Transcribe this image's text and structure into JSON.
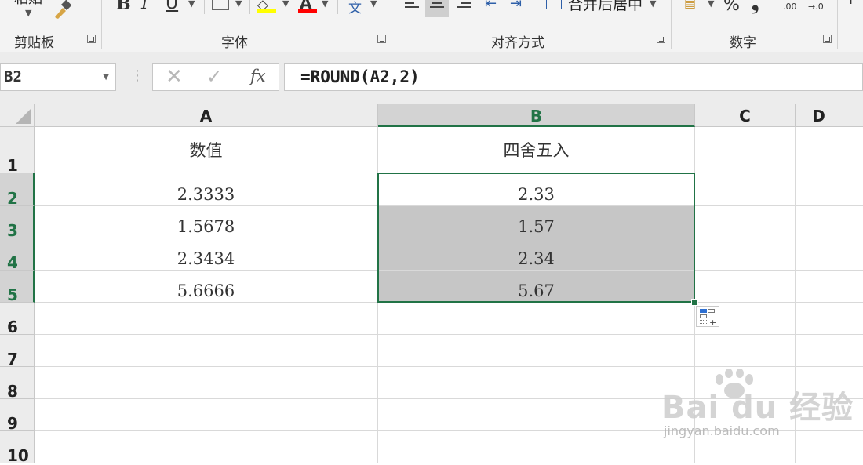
{
  "ribbon": {
    "paste_label_partial": "粘贴",
    "groups": {
      "clipboard": "剪贴板",
      "font": "字体",
      "alignment": "对齐方式",
      "number": "数字"
    },
    "font_buttons": {
      "bold": "B",
      "italic": "I",
      "underline": "U"
    },
    "merge_center": "合并后居中",
    "wen": "文",
    "percent": "%",
    "comma": "❟",
    "dec_inc_top": "←.0",
    "dec_inc_bottom": ".00",
    "dec_dec_top": ".00",
    "dec_dec_bottom": "→.0",
    "font_colors": {
      "highlight": "#ffff00",
      "text": "#ff0000"
    }
  },
  "formula_bar": {
    "name_box": "B2",
    "fx": "fx",
    "formula": "=ROUND(A2,2)"
  },
  "sheet": {
    "columns": [
      "A",
      "B",
      "C",
      "D"
    ],
    "selected_column": "B",
    "rows": [
      "1",
      "2",
      "3",
      "4",
      "5",
      "6",
      "7",
      "8",
      "9",
      "10"
    ],
    "selected_rows": [
      "2",
      "3",
      "4",
      "5"
    ],
    "cells": {
      "A1": "数值",
      "B1": "四舍五入",
      "A2": "2.3333",
      "B2": "2.33",
      "A3": "1.5678",
      "B3": "1.57",
      "A4": "2.3434",
      "B4": "2.34",
      "A5": "5.6666",
      "B5": "5.67"
    },
    "accent": "#217346"
  },
  "watermark": {
    "logo": "Bai du 经验",
    "url": "jingyan.baidu.com"
  }
}
